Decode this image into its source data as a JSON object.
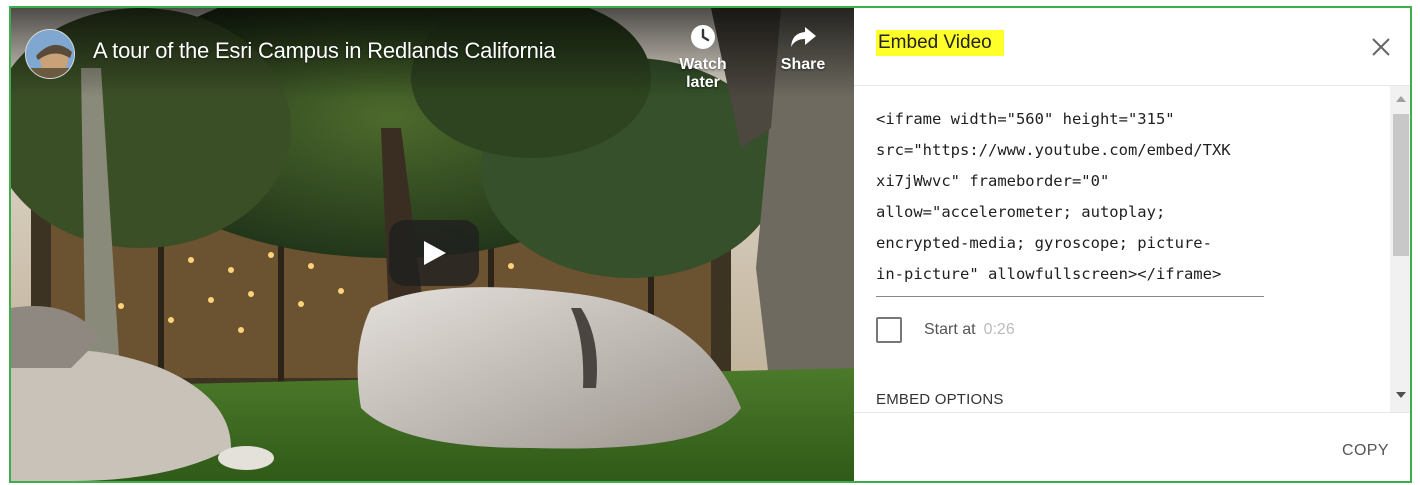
{
  "video": {
    "title": "A tour of the Esri Campus in Redlands California",
    "watch_later_label": "Watch later",
    "share_label": "Share",
    "icons": {
      "avatar": "channel-avatar",
      "watch_later": "clock-icon",
      "share": "share-arrow-icon",
      "play": "play-icon"
    }
  },
  "embed_panel": {
    "title": "Embed Video",
    "title_highlight_color": "#ffff2a",
    "close_icon": "close-icon",
    "code_lines": [
      "<iframe width=\"560\" height=\"315\"",
      "src=\"https://www.youtube.com/embed/TXK",
      "xi7jWwvc\" frameborder=\"0\"",
      "allow=\"accelerometer; autoplay;",
      "encrypted-media; gyroscope; picture-",
      "in-picture\" allowfullscreen></iframe>"
    ],
    "start_at_label": "Start at",
    "start_at_time": "0:26",
    "start_at_checked": false,
    "embed_options_label": "EMBED OPTIONS",
    "copy_label": "COPY"
  },
  "colors": {
    "frame_border": "#3fae49"
  }
}
